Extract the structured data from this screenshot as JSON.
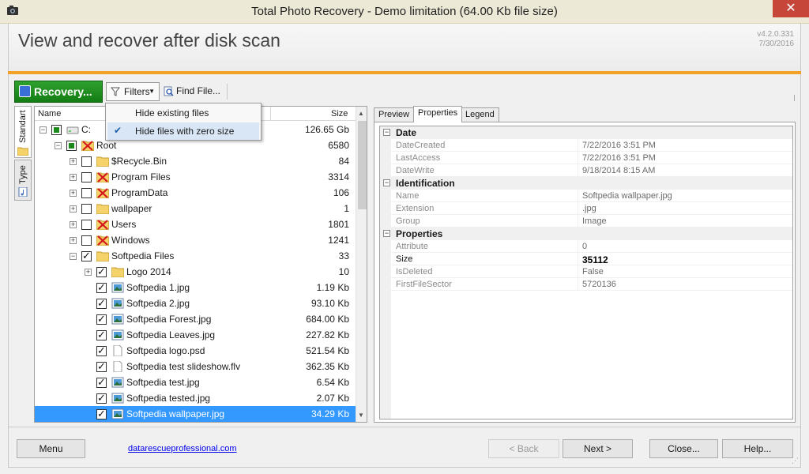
{
  "window": {
    "title": "Total Photo Recovery - Demo limitation (64.00 Kb file size)",
    "close_glyph": "✕"
  },
  "header": {
    "heading": "View and recover after disk scan",
    "version": "v4.2.0.331",
    "date": "7/30/2016"
  },
  "toolbar": {
    "recovery_label": "Recovery...",
    "filters_label": "Filters",
    "find_label": "Find File..."
  },
  "filters_menu": {
    "items": [
      {
        "label": "Hide existing files",
        "checked": false
      },
      {
        "label": "Hide files with zero size",
        "checked": true
      }
    ]
  },
  "left_tabs": {
    "standard": "Standart",
    "type": "Type"
  },
  "tree": {
    "col_name": "Name",
    "col_size": "Size",
    "rows": [
      {
        "label": "C:",
        "size": "126.65 Gb",
        "level": 0,
        "check": "partial",
        "icon": "drive-icon",
        "expander": "−"
      },
      {
        "label": "Root",
        "size": "6580",
        "level": 1,
        "check": "partial",
        "icon": "deleted-folder-icon",
        "expander": "−"
      },
      {
        "label": "$Recycle.Bin",
        "size": "84",
        "level": 2,
        "check": "none",
        "icon": "folder-icon",
        "expander": "+"
      },
      {
        "label": "Program Files",
        "size": "3314",
        "level": 2,
        "check": "none",
        "icon": "deleted-folder-icon",
        "expander": "+"
      },
      {
        "label": "ProgramData",
        "size": "106",
        "level": 2,
        "check": "none",
        "icon": "deleted-folder-icon",
        "expander": "+"
      },
      {
        "label": "wallpaper",
        "size": "1",
        "level": 2,
        "check": "none",
        "icon": "folder-icon",
        "expander": "+"
      },
      {
        "label": "Users",
        "size": "1801",
        "level": 2,
        "check": "none",
        "icon": "deleted-folder-icon",
        "expander": "+"
      },
      {
        "label": "Windows",
        "size": "1241",
        "level": 2,
        "check": "none",
        "icon": "deleted-folder-icon",
        "expander": "+"
      },
      {
        "label": "Softpedia Files",
        "size": "33",
        "level": 2,
        "check": "checked",
        "icon": "folder-icon",
        "expander": "−"
      },
      {
        "label": "Logo 2014",
        "size": "10",
        "level": 3,
        "check": "checked",
        "icon": "folder-icon",
        "expander": "+"
      },
      {
        "label": "Softpedia 1.jpg",
        "size": "1.19 Kb",
        "level": 3,
        "check": "checked",
        "icon": "image-file-icon",
        "expander": ""
      },
      {
        "label": "Softpedia 2.jpg",
        "size": "93.10 Kb",
        "level": 3,
        "check": "checked",
        "icon": "image-file-icon",
        "expander": ""
      },
      {
        "label": "Softpedia Forest.jpg",
        "size": "684.00 Kb",
        "level": 3,
        "check": "checked",
        "icon": "image-file-icon",
        "expander": ""
      },
      {
        "label": "Softpedia Leaves.jpg",
        "size": "227.82 Kb",
        "level": 3,
        "check": "checked",
        "icon": "image-file-icon",
        "expander": ""
      },
      {
        "label": "Softpedia logo.psd",
        "size": "521.54 Kb",
        "level": 3,
        "check": "checked",
        "icon": "generic-file-icon",
        "expander": ""
      },
      {
        "label": "Softpedia test slideshow.flv",
        "size": "362.35 Kb",
        "level": 3,
        "check": "checked",
        "icon": "generic-file-icon",
        "expander": ""
      },
      {
        "label": "Softpedia test.jpg",
        "size": "6.54 Kb",
        "level": 3,
        "check": "checked",
        "icon": "image-file-icon",
        "expander": ""
      },
      {
        "label": "Softpedia tested.jpg",
        "size": "2.07 Kb",
        "level": 3,
        "check": "checked",
        "icon": "image-file-icon",
        "expander": ""
      },
      {
        "label": "Softpedia wallpaper.jpg",
        "size": "34.29 Kb",
        "level": 3,
        "check": "checked",
        "icon": "image-file-icon",
        "expander": "",
        "selected": true
      }
    ]
  },
  "right_tabs": {
    "preview": "Preview",
    "properties": "Properties",
    "legend": "Legend"
  },
  "properties": {
    "categories": [
      {
        "name": "Date",
        "rows": [
          {
            "key": "DateCreated",
            "value": "7/22/2016 3:51 PM"
          },
          {
            "key": "LastAccess",
            "value": "7/22/2016 3:51 PM"
          },
          {
            "key": "DateWrite",
            "value": "9/18/2014 8:15 AM"
          }
        ]
      },
      {
        "name": "Identification",
        "rows": [
          {
            "key": "Name",
            "value": "Softpedia wallpaper.jpg"
          },
          {
            "key": "Extension",
            "value": ".jpg"
          },
          {
            "key": "Group",
            "value": "Image"
          }
        ]
      },
      {
        "name": "Properties",
        "rows": [
          {
            "key": "Attribute",
            "value": "0"
          },
          {
            "key": "Size",
            "value": "35112",
            "bold": true
          },
          {
            "key": "IsDeleted",
            "value": "False"
          },
          {
            "key": "FirstFileSector",
            "value": "5720136"
          }
        ]
      }
    ]
  },
  "footer": {
    "menu": "Menu",
    "link": "datarescueprofessional.com",
    "back": "< Back",
    "next": "Next >",
    "close": "Close...",
    "help": "Help..."
  },
  "colors": {
    "accent_orange": "#f2a227",
    "recovery_green": "#137d13",
    "selection_blue": "#3399ff",
    "close_red": "#c7463a"
  }
}
